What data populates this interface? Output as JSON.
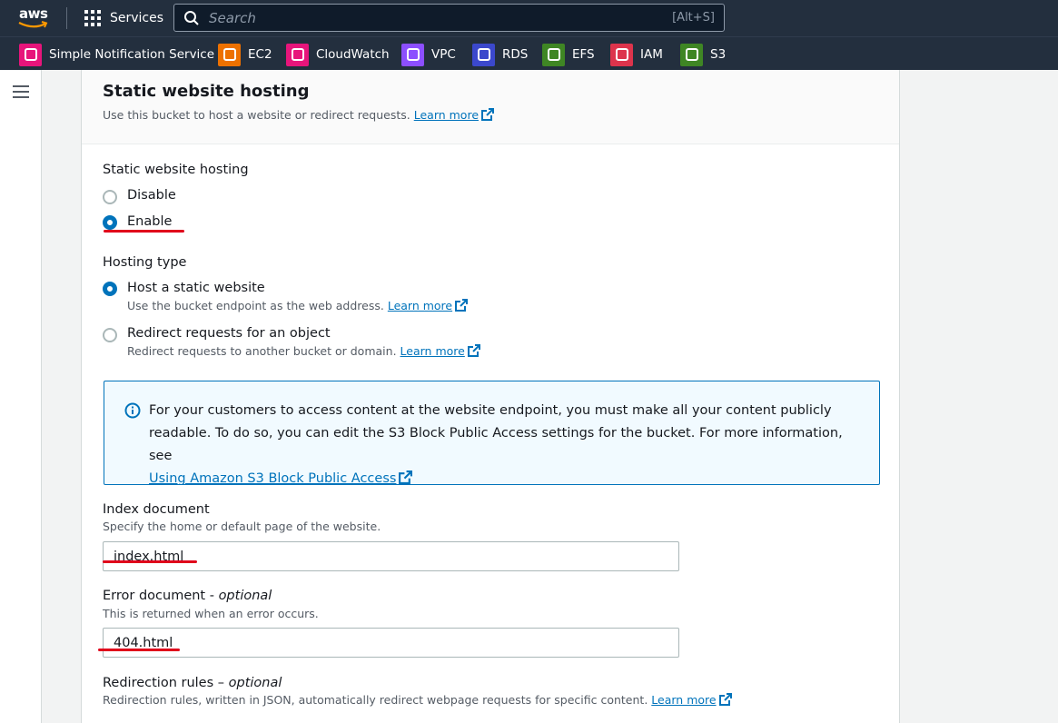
{
  "topnav": {
    "logo": "aws",
    "services_label": "Services",
    "search_placeholder": "Search",
    "search_shortcut": "[Alt+S]"
  },
  "favorites": [
    {
      "label": "Simple Notification Service",
      "icon": "sns-icon",
      "color": "#e7157b"
    },
    {
      "label": "EC2",
      "icon": "ec2-icon",
      "color": "#ed7100"
    },
    {
      "label": "CloudWatch",
      "icon": "cloudwatch-icon",
      "color": "#e7157b"
    },
    {
      "label": "VPC",
      "icon": "vpc-icon",
      "color": "#8c4fff"
    },
    {
      "label": "RDS",
      "icon": "rds-icon",
      "color": "#3b48cc"
    },
    {
      "label": "EFS",
      "icon": "efs-icon",
      "color": "#3f8624"
    },
    {
      "label": "IAM",
      "icon": "iam-icon",
      "color": "#dd344c"
    },
    {
      "label": "S3",
      "icon": "s3-icon",
      "color": "#3f8624"
    }
  ],
  "section": {
    "title": "Static website hosting",
    "description": "Use this bucket to host a website or redirect requests.",
    "learn_more": "Learn more"
  },
  "hosting": {
    "label": "Static website hosting",
    "options": [
      "Disable",
      "Enable"
    ],
    "selected": "Enable"
  },
  "hosting_type": {
    "label": "Hosting type",
    "options": [
      {
        "label": "Host a static website",
        "desc": "Use the bucket endpoint as the web address.",
        "link": "Learn more",
        "selected": true
      },
      {
        "label": "Redirect requests for an object",
        "desc": "Redirect requests to another bucket or domain.",
        "link": "Learn more",
        "selected": false
      }
    ]
  },
  "info_alert": {
    "text": "For your customers to access content at the website endpoint, you must make all your content publicly readable. To do so, you can edit the S3 Block Public Access settings for the bucket. For more information, see",
    "link": "Using Amazon S3 Block Public Access"
  },
  "index_document": {
    "label": "Index document",
    "desc": "Specify the home or default page of the website.",
    "value": "index.html"
  },
  "error_document": {
    "label": "Error document - ",
    "label_optional": "optional",
    "desc": "This is returned when an error occurs.",
    "value": "404.html"
  },
  "redirection_rules": {
    "label": "Redirection rules – ",
    "label_optional": "optional",
    "desc": "Redirection rules, written in JSON, automatically redirect webpage requests for specific content.",
    "link": "Learn more"
  },
  "colors": {
    "nav_bg": "#232f3e",
    "link": "#0073bb",
    "annotation_red": "#e0001b"
  }
}
